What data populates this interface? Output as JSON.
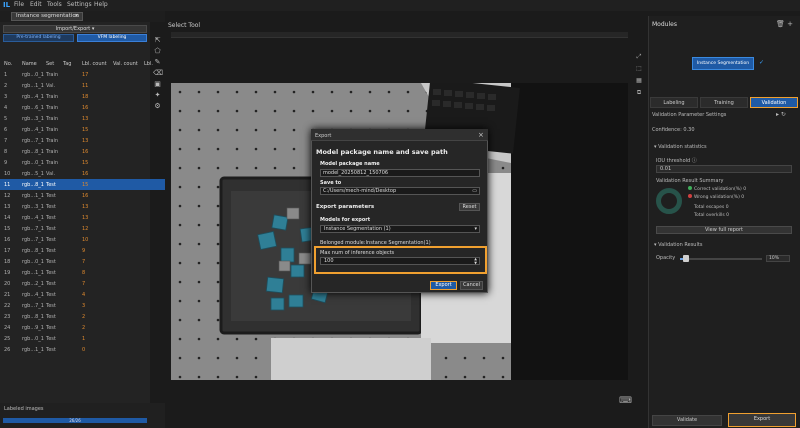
{
  "menu": {
    "logo": "IL",
    "items": [
      "File",
      "Edit",
      "Tools",
      "Settings",
      "Help"
    ]
  },
  "project_tab": {
    "label": "Instance segmentation",
    "close": "×"
  },
  "left": {
    "import_export": "Import/Export ▾",
    "pre_label": "Pre-trained labeling",
    "vfm_label": "VFM labeling",
    "table": {
      "headers": [
        "No.",
        "Name",
        "Set",
        "Tag",
        "Lbl. count",
        "Val. count",
        "Lbl."
      ],
      "rows": [
        [
          "1",
          "rgb...0_1",
          "Train",
          "",
          "17"
        ],
        [
          "2",
          "rgb...1_1",
          "Val.",
          "",
          "11"
        ],
        [
          "3",
          "rgb...4_1",
          "Train",
          "",
          "18"
        ],
        [
          "4",
          "rgb...6_1",
          "Train",
          "",
          "16"
        ],
        [
          "5",
          "rgb...3_1",
          "Train",
          "",
          "13"
        ],
        [
          "6",
          "rgb...4_1",
          "Train",
          "",
          "15"
        ],
        [
          "7",
          "rgb...7_1",
          "Train",
          "",
          "13"
        ],
        [
          "8",
          "rgb...8_1",
          "Train",
          "",
          "16"
        ],
        [
          "9",
          "rgb...0_1",
          "Train",
          "",
          "15"
        ],
        [
          "10",
          "rgb...5_1",
          "Val.",
          "",
          "16"
        ],
        [
          "11",
          "rgb...8_1",
          "Test",
          "",
          "15"
        ],
        [
          "12",
          "rgb...1_1",
          "Test",
          "",
          "16"
        ],
        [
          "13",
          "rgb...3_1",
          "Test",
          "",
          "13"
        ],
        [
          "14",
          "rgb...4_1",
          "Test",
          "",
          "13"
        ],
        [
          "15",
          "rgb...7_1",
          "Test",
          "",
          "12"
        ],
        [
          "16",
          "rgb...7_1",
          "Test",
          "",
          "10"
        ],
        [
          "17",
          "rgb...8_1",
          "Test",
          "",
          "9"
        ],
        [
          "18",
          "rgb...0_1",
          "Test",
          "",
          "7"
        ],
        [
          "19",
          "rgb...1_1",
          "Test",
          "",
          "8"
        ],
        [
          "20",
          "rgb...2_1",
          "Test",
          "",
          "7"
        ],
        [
          "21",
          "rgb...4_1",
          "Test",
          "",
          "4"
        ],
        [
          "22",
          "rgb...7_1",
          "Test",
          "",
          "3"
        ],
        [
          "23",
          "rgb...8_1",
          "Test",
          "",
          "2"
        ],
        [
          "24",
          "rgb...9_1",
          "Test",
          "",
          "2"
        ],
        [
          "25",
          "rgb...0_1",
          "Test",
          "",
          "1"
        ],
        [
          "26",
          "rgb...1_1",
          "Test",
          "",
          "0"
        ]
      ],
      "selected_index": 10
    },
    "labeled_images": "Labeled images",
    "progress_text": "26/26",
    "progress_fraction": 1.0
  },
  "canvas": {
    "select_tool": "Select Tool"
  },
  "right": {
    "modules_title": "Modules",
    "modules_icons": "🗑 +",
    "module_name": "Instance Segmentation",
    "module_check": "✓",
    "tabs": [
      "Labeling",
      "Training",
      "Validation"
    ],
    "active_tab": 2,
    "val_params": "Validation Parameter Settings",
    "val_icons": "▸ ↻",
    "confidence": "Confidence: 0.30",
    "val_stats": "▾  Validation statistics",
    "iou_label": "IOU threshold  ⓘ",
    "iou_value": "0.01",
    "vrs": "Validation Result Summary",
    "legend": [
      "Correct validation(%)",
      "Wrong validation(%)",
      "Total escapes",
      "Total overkills"
    ],
    "legend_values": [
      "0",
      "0",
      "0",
      "0"
    ],
    "view_full": "View full report",
    "val_results": "▾  Validation Results",
    "opacity_label": "Opacity",
    "opacity_value": "10%",
    "opacity_fraction": 0.1,
    "validate": "Validate",
    "export": "Export"
  },
  "dialog": {
    "title": "Export",
    "close": "×",
    "heading": "Model package name and save path",
    "pkg_label": "Model package name",
    "pkg_value": "model_20250812_150706",
    "saveto_label": "Save to",
    "saveto_value": "C:/Users/mech-mind/Desktop",
    "export_params": "Export parameters",
    "reset": "Reset",
    "models_label": "Models for export",
    "models_value": "Instance Segmentation (1)",
    "belonged": "Belonged module:Instance Segmentation(1)",
    "maxnum_label": "Max num of inference objects",
    "maxnum_value": "100",
    "export_btn": "Export",
    "cancel_btn": "Cancel"
  },
  "colors": {
    "accent": "#1f5aa5",
    "highlight": "#f0a030",
    "count": "#e08a2e"
  }
}
